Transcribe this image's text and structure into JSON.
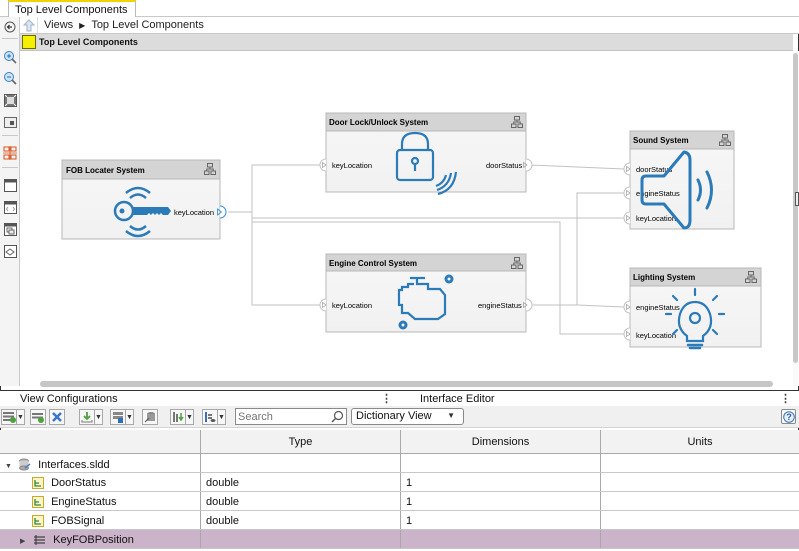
{
  "app": {
    "tab_title": "Top Level Components"
  },
  "breadcrumb": {
    "items": [
      "Views",
      "Top Level Components"
    ]
  },
  "canvas": {
    "title": "Top Level Components",
    "components": [
      {
        "id": "fob",
        "name": "FOB Locater System",
        "icon": "key-signal-icon",
        "inports": [],
        "outports": [
          "keyLocation"
        ]
      },
      {
        "id": "door",
        "name": "Door Lock/Unlock System",
        "icon": "padlock-signal-icon",
        "inports": [
          "keyLocation"
        ],
        "outports": [
          "doorStatus"
        ]
      },
      {
        "id": "engine",
        "name": "Engine Control System",
        "icon": "engine-icon",
        "inports": [
          "keyLocation"
        ],
        "outports": [
          "engineStatus"
        ]
      },
      {
        "id": "sound",
        "name": "Sound System",
        "icon": "speaker-icon",
        "inports": [
          "doorStatus",
          "engineStatus",
          "keyLocation"
        ],
        "outports": []
      },
      {
        "id": "lighting",
        "name": "Lighting System",
        "icon": "lightbulb-icon",
        "inports": [
          "engineStatus",
          "keyLocation"
        ],
        "outports": []
      }
    ]
  },
  "panels": {
    "left_title": "View Configurations",
    "right_title": "Interface Editor"
  },
  "toolbar": {
    "search_placeholder": "Search",
    "view_mode": "Dictionary View"
  },
  "table": {
    "columns": [
      "",
      "Type",
      "Dimensions",
      "Units"
    ],
    "root": "Interfaces.sldd",
    "rows": [
      {
        "name": "DoorStatus",
        "type": "double",
        "dimensions": "1",
        "units": ""
      },
      {
        "name": "EngineStatus",
        "type": "double",
        "dimensions": "1",
        "units": ""
      },
      {
        "name": "FOBSignal",
        "type": "double",
        "dimensions": "1",
        "units": ""
      },
      {
        "name": "KeyFOBPosition",
        "type": "",
        "dimensions": "",
        "units": "",
        "selected": true
      }
    ]
  },
  "colors": {
    "accent_blue": "#2b7bb9",
    "block_header": "#d4d4d4",
    "selected_row": "#cbb3ca",
    "tab_highlight": "#f2d200"
  }
}
